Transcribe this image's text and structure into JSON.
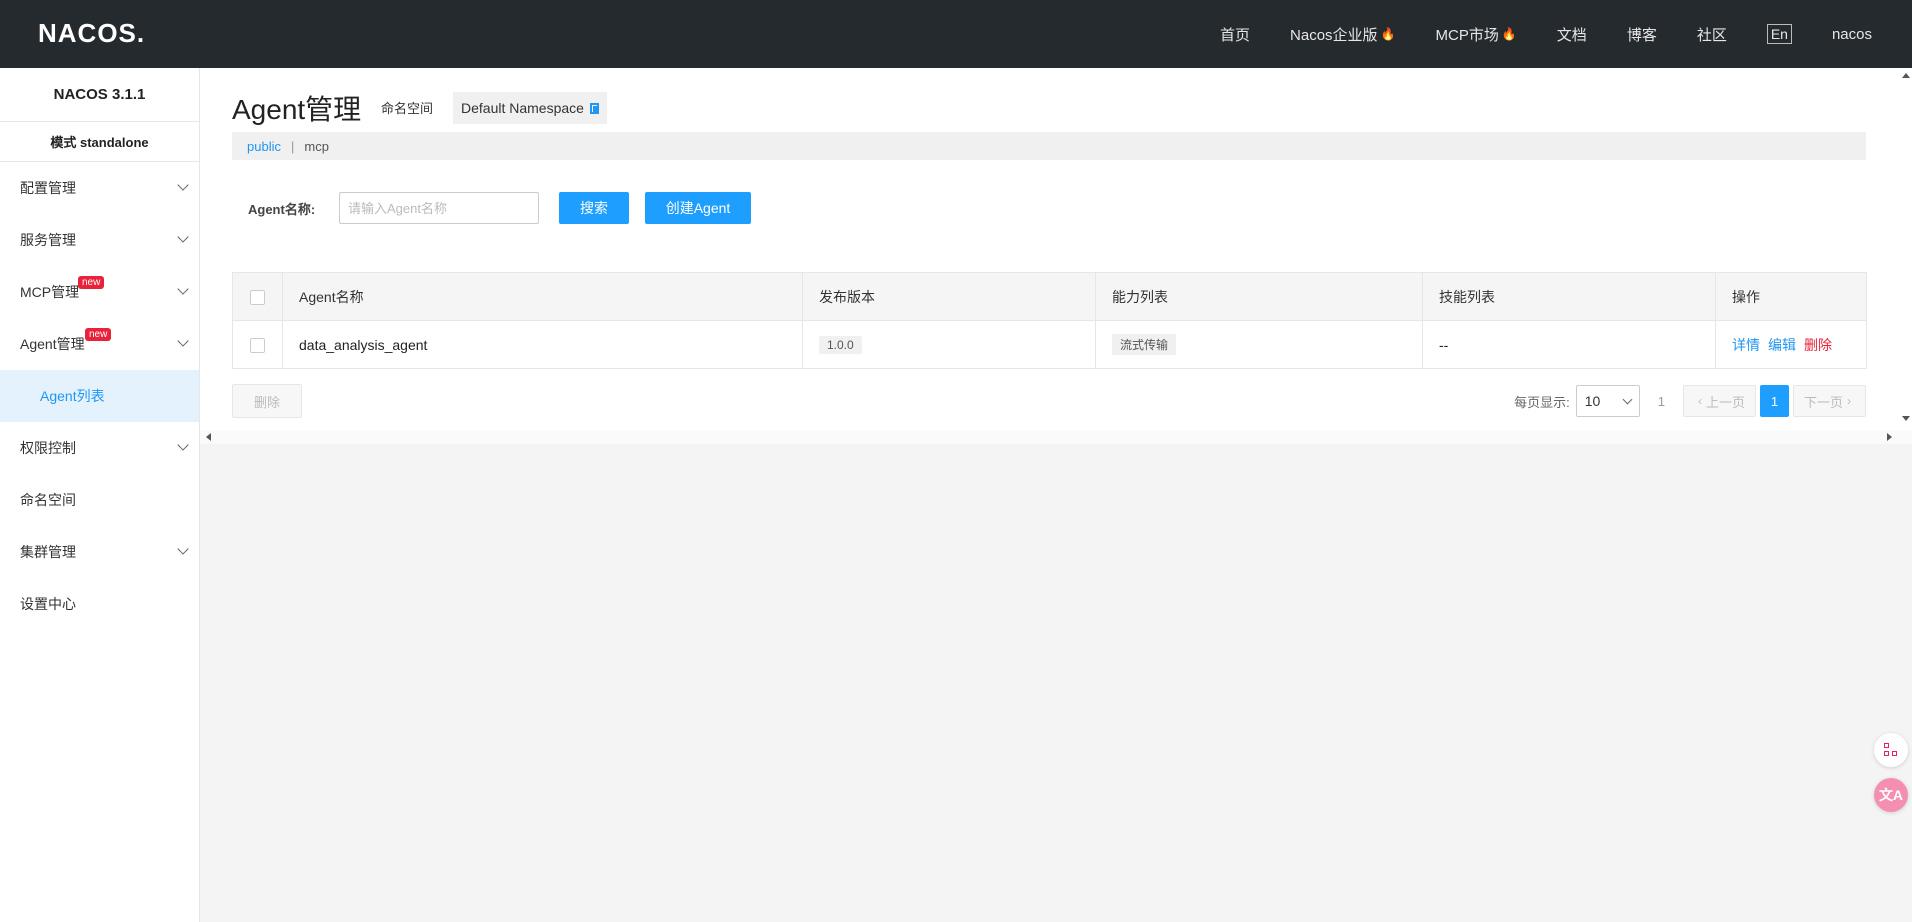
{
  "header": {
    "logo": "NACOS.",
    "nav": [
      {
        "label": "首页",
        "hot": false
      },
      {
        "label": "Nacos企业版",
        "hot": true
      },
      {
        "label": "MCP市场",
        "hot": true
      },
      {
        "label": "文档",
        "hot": false
      },
      {
        "label": "博客",
        "hot": false
      },
      {
        "label": "社区",
        "hot": false
      }
    ],
    "lang": "En",
    "user": "nacos"
  },
  "sidebar": {
    "version": "NACOS 3.1.1",
    "mode": "模式 standalone",
    "items": [
      {
        "label": "配置管理",
        "expandable": true
      },
      {
        "label": "服务管理",
        "expandable": true
      },
      {
        "label": "MCP管理",
        "expandable": true,
        "badge": "new"
      },
      {
        "label": "Agent管理",
        "expandable": true,
        "badge": "new"
      },
      {
        "label": "Agent列表",
        "sub": true,
        "active": true
      },
      {
        "label": "权限控制",
        "expandable": true
      },
      {
        "label": "命名空间",
        "expandable": false
      },
      {
        "label": "集群管理",
        "expandable": true
      },
      {
        "label": "设置中心",
        "expandable": false
      }
    ]
  },
  "main": {
    "title": "Agent管理",
    "namespace_label": "命名空间",
    "namespace_value": "Default Namespace",
    "ns_tabs": [
      "public",
      "mcp"
    ],
    "search": {
      "label": "Agent名称:",
      "placeholder": "请输入Agent名称",
      "search_btn": "搜索",
      "create_btn": "创建Agent"
    },
    "table": {
      "columns": [
        "Agent名称",
        "发布版本",
        "能力列表",
        "技能列表",
        "操作"
      ],
      "rows": [
        {
          "name": "data_analysis_agent",
          "version": "1.0.0",
          "capability": "流式传输",
          "skills": "--",
          "ops": [
            "详情",
            "编辑",
            "删除"
          ]
        }
      ]
    },
    "delete_btn": "删除",
    "pager": {
      "per_page_label": "每页显示:",
      "per_page": "10",
      "total": "1",
      "prev": "上一页",
      "next": "下一页",
      "current": "1"
    }
  },
  "colors": {
    "header_bg": "#252a2f",
    "primary": "#1e9fff",
    "danger": "#e8223b",
    "active_bg": "#e3f2fd"
  }
}
